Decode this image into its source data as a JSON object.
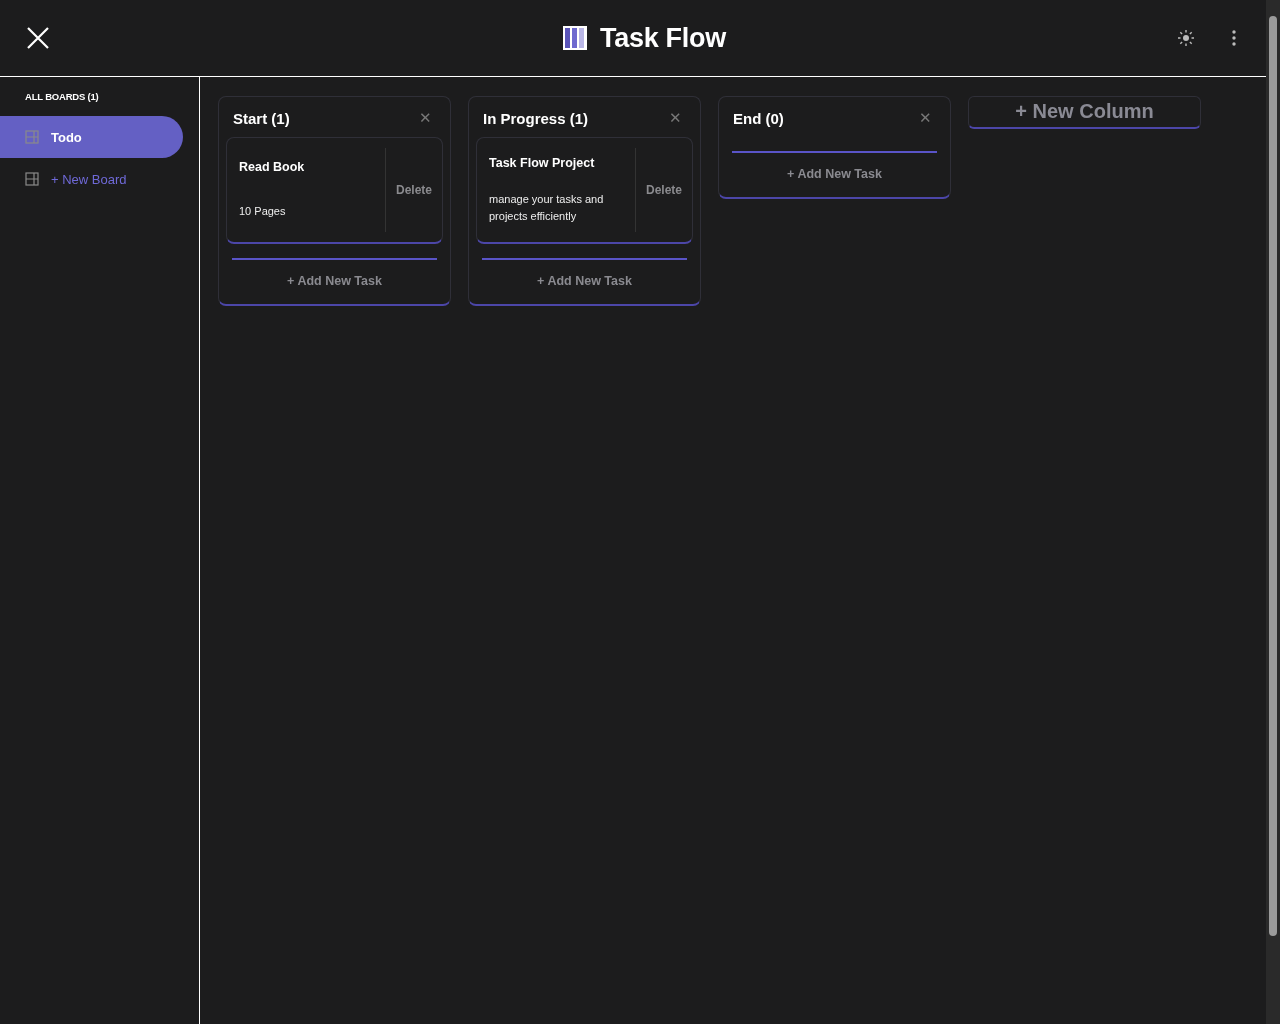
{
  "header": {
    "title": "Task Flow"
  },
  "sidebar": {
    "heading": "ALL BOARDS (1)",
    "boards": [
      {
        "label": "Todo",
        "selected": true
      }
    ],
    "new_board": "+ New Board"
  },
  "columns": [
    {
      "title": "Start (1)",
      "close": "✕",
      "tasks": [
        {
          "title": "Read Book",
          "description": "10 Pages",
          "delete": "Delete"
        }
      ],
      "add_task": "+ Add New Task"
    },
    {
      "title": "In Progress (1)",
      "close": "✕",
      "tasks": [
        {
          "title": "Task Flow Project",
          "description": "manage your tasks and projects efficiently",
          "delete": "Delete"
        }
      ],
      "add_task": "+ Add New Task"
    },
    {
      "title": "End (0)",
      "close": "✕",
      "add_task": "+ Add New Task"
    }
  ],
  "new_column": "+ New Column"
}
